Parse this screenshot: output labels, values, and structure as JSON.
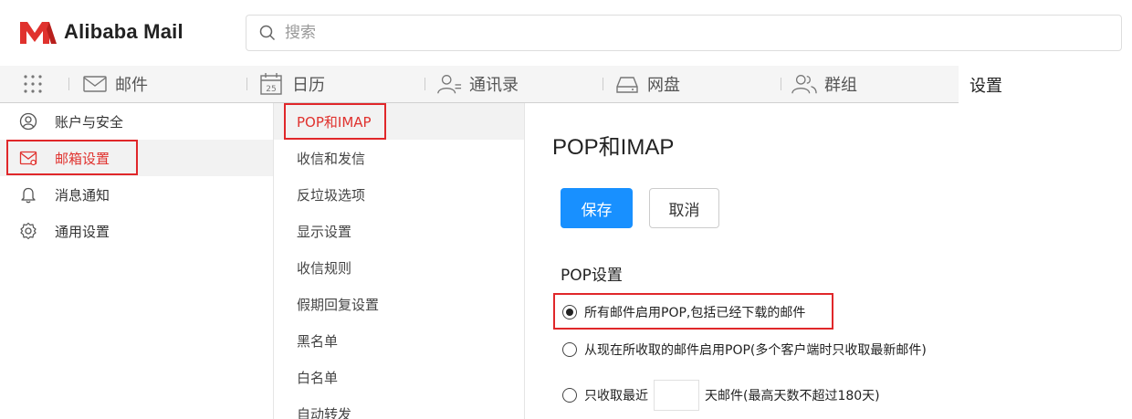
{
  "brand": {
    "name": "Alibaba Mail",
    "accent": "#e0322e",
    "primary": "#1890ff"
  },
  "search": {
    "placeholder": "搜索"
  },
  "nav": {
    "items": [
      {
        "label": "邮件",
        "icon": "mail-icon"
      },
      {
        "label": "日历",
        "icon": "calendar-icon",
        "calendar_day": "25"
      },
      {
        "label": "通讯录",
        "icon": "contacts-icon"
      },
      {
        "label": "网盘",
        "icon": "drive-icon"
      },
      {
        "label": "群组",
        "icon": "group-icon"
      },
      {
        "label": "设置",
        "active": true
      }
    ]
  },
  "sidebar": {
    "items": [
      {
        "label": "账户与安全",
        "icon": "user-icon"
      },
      {
        "label": "邮箱设置",
        "icon": "mailbox-settings-icon",
        "active": true
      },
      {
        "label": "消息通知",
        "icon": "bell-icon"
      },
      {
        "label": "通用设置",
        "icon": "gear-icon"
      }
    ]
  },
  "submenu": {
    "items": [
      {
        "label": "POP和IMAP",
        "active": true
      },
      {
        "label": "收信和发信"
      },
      {
        "label": "反垃圾选项"
      },
      {
        "label": "显示设置"
      },
      {
        "label": "收信规则"
      },
      {
        "label": "假期回复设置"
      },
      {
        "label": "黑名单"
      },
      {
        "label": "白名单"
      },
      {
        "label": "自动转发"
      }
    ]
  },
  "content": {
    "title": "POP和IMAP",
    "save_label": "保存",
    "cancel_label": "取消",
    "pop_section_title": "POP设置",
    "options": [
      {
        "label": "所有邮件启用POP,包括已经下载的邮件",
        "checked": true
      },
      {
        "label": "从现在所收取的邮件启用POP(多个客户端时只收取最新邮件)",
        "checked": false
      },
      {
        "prefix": "只收取最近",
        "suffix": "天邮件(最高天数不超过180天)",
        "checked": false,
        "days_value": ""
      }
    ]
  }
}
